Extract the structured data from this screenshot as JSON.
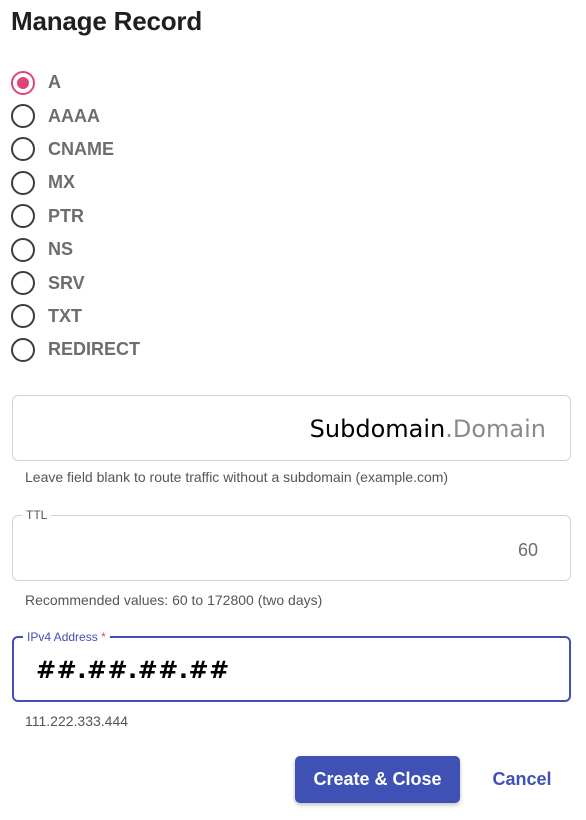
{
  "dialog": {
    "title": "Manage Record"
  },
  "record_types": {
    "selected": "A",
    "options": [
      {
        "label": "A"
      },
      {
        "label": "AAAA"
      },
      {
        "label": "CNAME"
      },
      {
        "label": "MX"
      },
      {
        "label": "PTR"
      },
      {
        "label": "NS"
      },
      {
        "label": "SRV"
      },
      {
        "label": "TXT"
      },
      {
        "label": "REDIRECT"
      }
    ]
  },
  "subdomain_field": {
    "value_subdomain": "Subdomain",
    "value_domain": ".Domain",
    "helper": "Leave field blank to route traffic without a subdomain (example.com)"
  },
  "ttl_field": {
    "label": "TTL",
    "value": "60",
    "helper": "Recommended values: 60 to 172800 (two days)"
  },
  "ipv4_field": {
    "label": "IPv4 Address",
    "required_marker": "*",
    "value": "##.##.##.##",
    "helper": "111.222.333.444"
  },
  "actions": {
    "create_label": "Create & Close",
    "cancel_label": "Cancel"
  },
  "colors": {
    "accent": "#3f51b5",
    "radio_selected": "#e0457a"
  }
}
